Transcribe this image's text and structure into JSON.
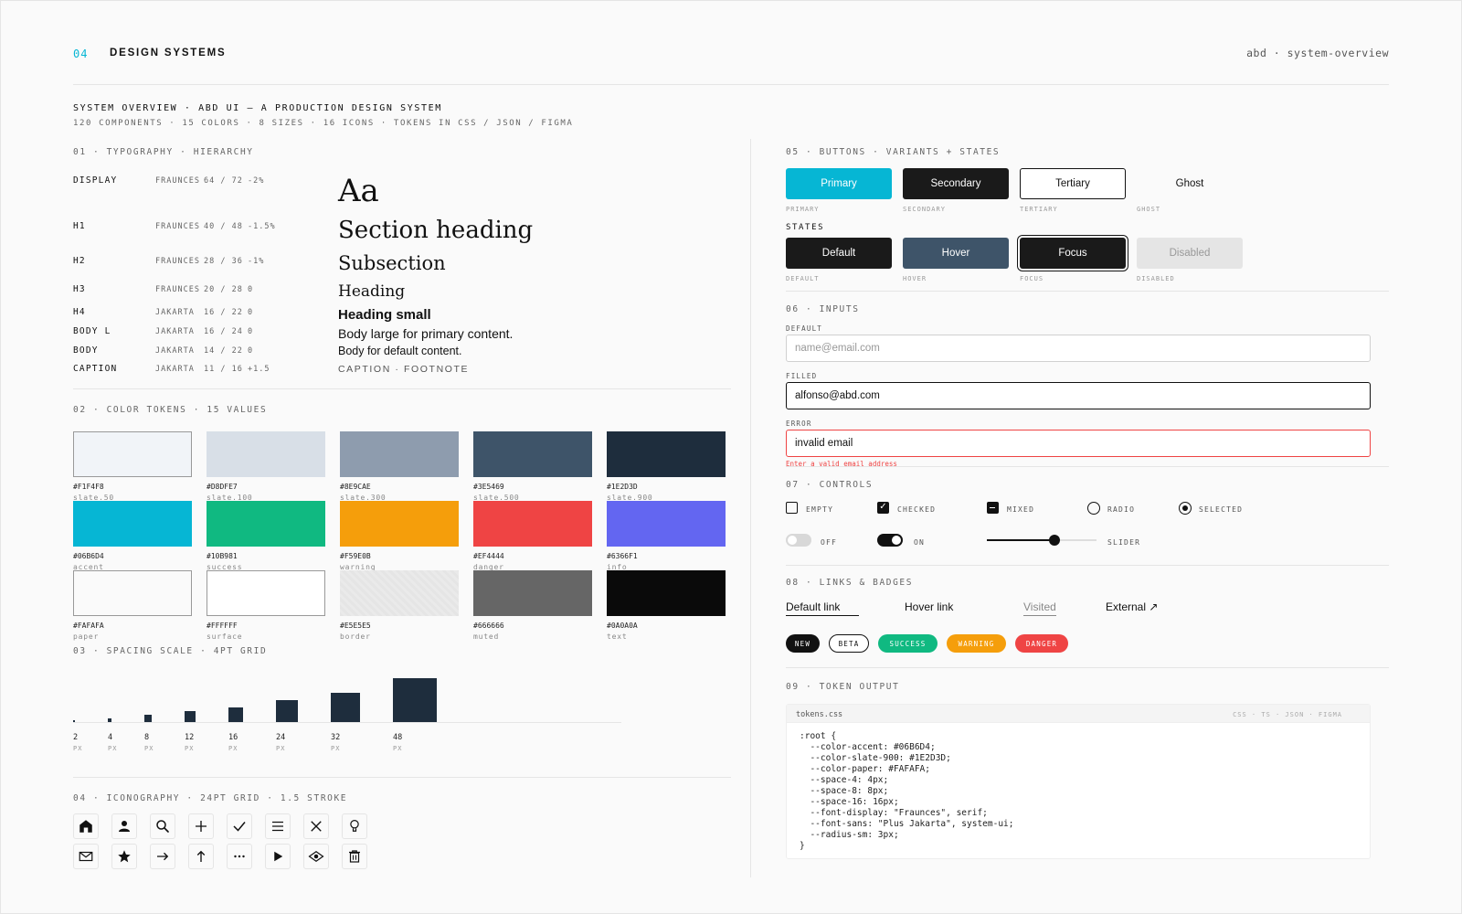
{
  "header": {
    "number": "04",
    "title": "DESIGN SYSTEMS",
    "right": "abd · system-overview"
  },
  "overview": {
    "title": "SYSTEM OVERVIEW · ABD UI — A PRODUCTION DESIGN SYSTEM",
    "subtitle": "120 COMPONENTS · 15 COLORS · 8 SIZES · 16 ICONS · TOKENS IN CSS / JSON / FIGMA"
  },
  "typography": {
    "heading": "01 · TYPOGRAPHY · HIERARCHY",
    "rows": [
      {
        "name": "DISPLAY",
        "font": "FRAUNCES",
        "size": "64 / 72",
        "track": "-2%",
        "sample": "Aa"
      },
      {
        "name": "H1",
        "font": "FRAUNCES",
        "size": "40 / 48",
        "track": "-1.5%",
        "sample": "Section heading"
      },
      {
        "name": "H2",
        "font": "FRAUNCES",
        "size": "28 / 36",
        "track": "-1%",
        "sample": "Subsection"
      },
      {
        "name": "H3",
        "font": "FRAUNCES",
        "size": "20 / 28",
        "track": "0",
        "sample": "Heading"
      },
      {
        "name": "H4",
        "font": "JAKARTA",
        "size": "16 / 22",
        "track": "0",
        "sample": "Heading small"
      },
      {
        "name": "BODY L",
        "font": "JAKARTA",
        "size": "16 / 24",
        "track": "0",
        "sample": "Body large for primary content."
      },
      {
        "name": "BODY",
        "font": "JAKARTA",
        "size": "14 / 22",
        "track": "0",
        "sample": "Body for default content."
      },
      {
        "name": "CAPTION",
        "font": "JAKARTA",
        "size": "11 / 16",
        "track": "+1.5",
        "sample": "CAPTION · FOOTNOTE"
      }
    ]
  },
  "colors": {
    "heading": "02 · COLOR TOKENS · 15 VALUES",
    "swatches": [
      {
        "hex": "#F1F4F8",
        "name": "slate.50",
        "color": "#F1F4F8"
      },
      {
        "hex": "#D8DFE7",
        "name": "slate.100",
        "color": "#D8DFE7"
      },
      {
        "hex": "#8E9CAE",
        "name": "slate.300",
        "color": "#8E9CAE"
      },
      {
        "hex": "#3E5469",
        "name": "slate.500",
        "color": "#3E5469"
      },
      {
        "hex": "#1E2D3D",
        "name": "slate.900",
        "color": "#1E2D3D"
      },
      {
        "hex": "#06B6D4",
        "name": "accent",
        "color": "#06B6D4"
      },
      {
        "hex": "#10B981",
        "name": "success",
        "color": "#10B981"
      },
      {
        "hex": "#F59E0B",
        "name": "warning",
        "color": "#F59E0B"
      },
      {
        "hex": "#EF4444",
        "name": "danger",
        "color": "#EF4444"
      },
      {
        "hex": "#6366F1",
        "name": "info",
        "color": "#6366F1"
      },
      {
        "hex": "#FAFAFA",
        "name": "paper",
        "color": "#FAFAFA"
      },
      {
        "hex": "#FFFFFF",
        "name": "surface",
        "color": "#FFFFFF"
      },
      {
        "hex": "#E5E5E5",
        "name": "border",
        "color": "#E5E5E5"
      },
      {
        "hex": "#666666",
        "name": "muted",
        "color": "#666666"
      },
      {
        "hex": "#0A0A0A",
        "name": "text",
        "color": "#0A0A0A"
      }
    ]
  },
  "spacing": {
    "heading": "03 · SPACING SCALE · 4PT GRID",
    "unit": "PX",
    "values": [
      "2",
      "4",
      "8",
      "12",
      "16",
      "24",
      "32",
      "48"
    ]
  },
  "icons": {
    "heading": "04 · ICONOGRAPHY · 24PT GRID · 1.5 STROKE",
    "row1": [
      "home-icon",
      "user-icon",
      "search-icon",
      "plus-icon",
      "check-icon",
      "menu-icon",
      "close-icon",
      "lightbulb-icon"
    ],
    "row2": [
      "mail-icon",
      "star-icon",
      "arrow-right-icon",
      "arrow-up-icon",
      "more-icon",
      "play-icon",
      "eye-icon",
      "trash-icon"
    ]
  },
  "buttons": {
    "heading": "05 · BUTTONS · VARIANTS + STATES",
    "variants": [
      {
        "label": "Primary",
        "caption": "PRIMARY"
      },
      {
        "label": "Secondary",
        "caption": "SECONDARY"
      },
      {
        "label": "Tertiary",
        "caption": "TERTIARY"
      },
      {
        "label": "Ghost",
        "caption": "GHOST"
      }
    ],
    "states_label": "STATES",
    "states": [
      {
        "label": "Default",
        "caption": "DEFAULT"
      },
      {
        "label": "Hover",
        "caption": "HOVER"
      },
      {
        "label": "Focus",
        "caption": "FOCUS"
      },
      {
        "label": "Disabled",
        "caption": "DISABLED"
      }
    ]
  },
  "inputs": {
    "heading": "06 · INPUTS",
    "default_label": "DEFAULT",
    "default_placeholder": "name@email.com",
    "filled_label": "FILLED",
    "filled_value": "alfonso@abd.com",
    "error_label": "ERROR",
    "error_value": "invalid email",
    "error_message": "Enter a valid email address"
  },
  "controls": {
    "heading": "07 · CONTROLS",
    "empty": "EMPTY",
    "checked": "CHECKED",
    "mixed": "MIXED",
    "radio": "RADIO",
    "selected": "SELECTED",
    "off": "OFF",
    "on": "ON",
    "slider": "SLIDER",
    "slider_value": 0.62
  },
  "links": {
    "heading": "08 · LINKS & BADGES",
    "default": "Default link",
    "hover": "Hover link",
    "visited": "Visited",
    "external": "External ↗",
    "badges": [
      "NEW",
      "BETA",
      "SUCCESS",
      "WARNING",
      "DANGER"
    ]
  },
  "tokens": {
    "heading": "09 · TOKEN OUTPUT",
    "filename": "tokens.css",
    "formats": "CSS · TS · JSON · FIGMA",
    "code": ":root {\n  --color-accent: #06B6D4;\n  --color-slate-900: #1E2D3D;\n  --color-paper: #FAFAFA;\n  --space-4: 4px;\n  --space-8: 8px;\n  --space-16: 16px;\n  --font-display: \"Fraunces\", serif;\n  --font-sans: \"Plus Jakarta\", system-ui;\n  --radius-sm: 3px;\n}"
  }
}
